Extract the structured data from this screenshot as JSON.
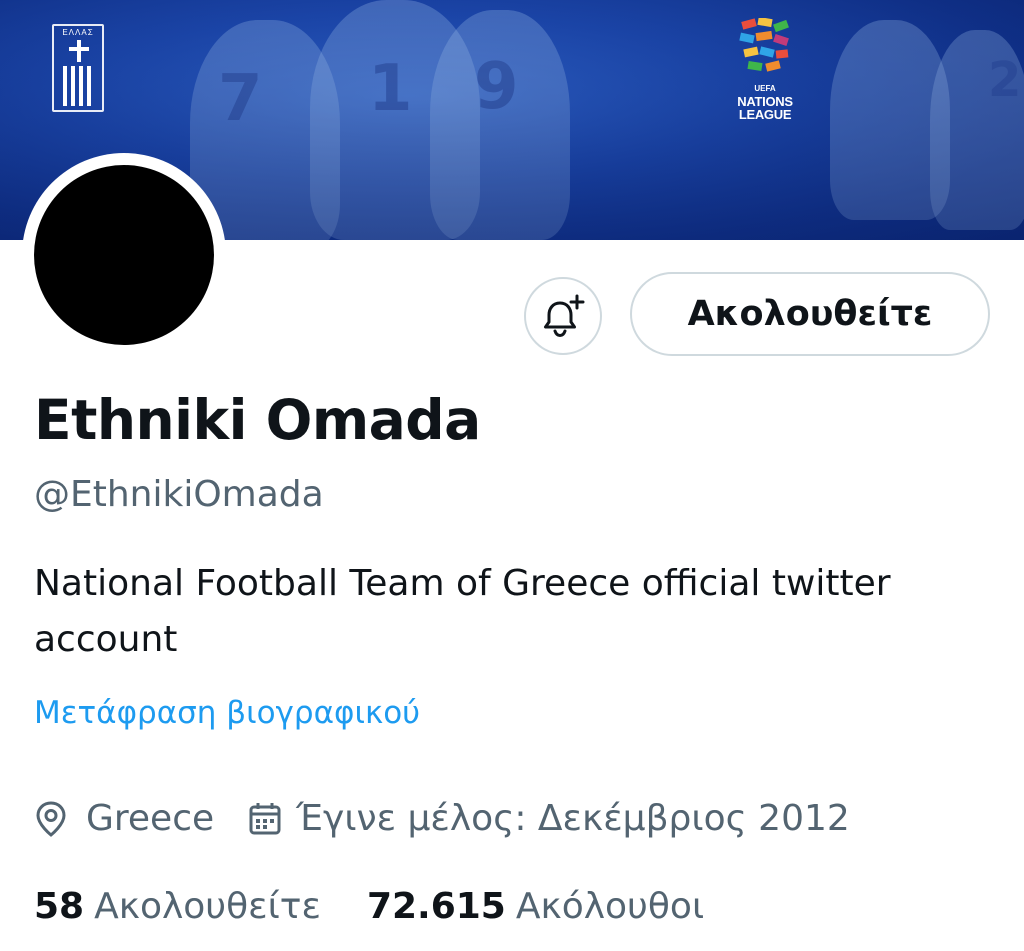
{
  "banner": {
    "crest_text": "ΕΛΛΑΣ",
    "league_logo": {
      "line1": "UEFA",
      "line2": "NATIONS",
      "line3": "LEAGUE"
    },
    "jersey_numbers": [
      "7",
      "1",
      "9",
      "2"
    ]
  },
  "profile": {
    "display_name": "Ethniki Omada",
    "handle": "@EthnikiOmada",
    "bio": "National Football Team of Greece official twitter account",
    "translate_bio": "Μετάφραση βιογραφικού",
    "location": "Greece",
    "joined": "Έγινε μέλος: Δεκέμβριος 2012"
  },
  "actions": {
    "follow_label": "Ακολουθείτε",
    "notify_icon": "bell-plus-icon"
  },
  "stats": {
    "following_count": "58",
    "following_label": "Ακολουθείτε",
    "followers_count": "72.615",
    "followers_label": "Ακόλουθοι"
  },
  "colors": {
    "link": "#1d9bf0",
    "secondary_text": "#536471",
    "primary_text": "#0f1419",
    "banner_blue": "#1b45a8",
    "border": "#cfd9de"
  }
}
